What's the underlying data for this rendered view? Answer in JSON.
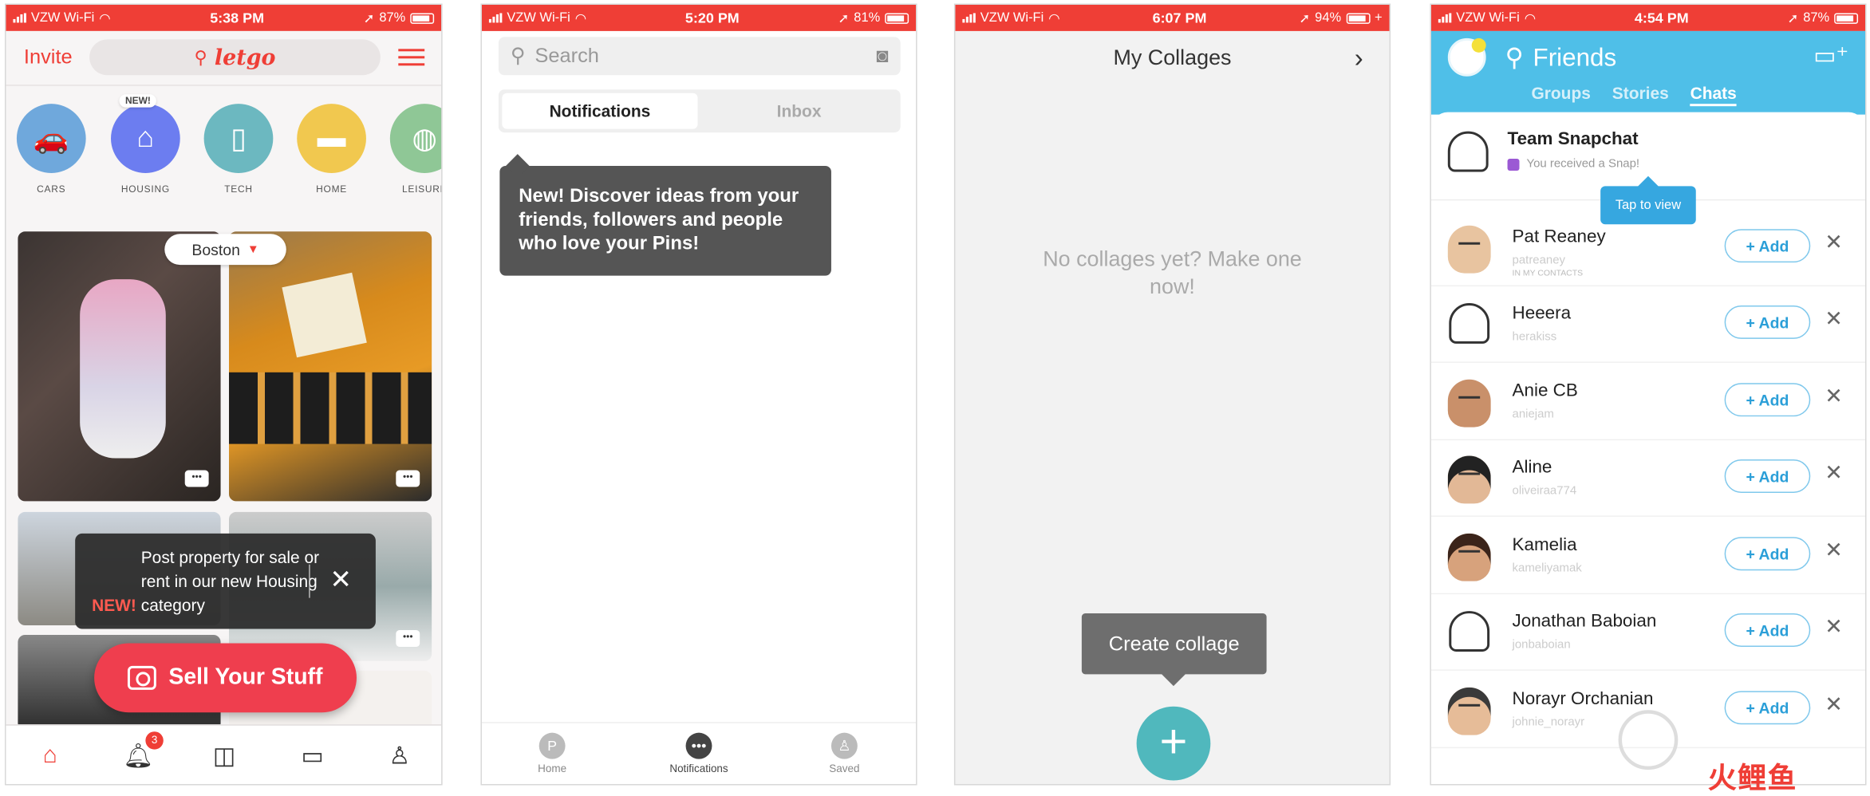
{
  "screens": {
    "letgo": {
      "status": {
        "carrier": "VZW Wi-Fi",
        "time": "5:38 PM",
        "battery": "87%"
      },
      "invite": "Invite",
      "logo": "letgo",
      "categories": [
        {
          "label": "CARS",
          "icon": "car-icon",
          "color": "#6fa8dc"
        },
        {
          "label": "HOUSING",
          "icon": "house-icon",
          "color": "#6c7df0",
          "badge": "NEW!"
        },
        {
          "label": "TECH",
          "icon": "phone-icon",
          "color": "#6cb8c0"
        },
        {
          "label": "HOME",
          "icon": "sofa-icon",
          "color": "#f1c84f"
        },
        {
          "label": "LEISURE",
          "icon": "ball-icon",
          "color": "#8fc796"
        }
      ],
      "location": "Boston",
      "tooltip": {
        "new": "NEW!",
        "text": "Post property for sale or rent in our new Housing category"
      },
      "sell_button": "Sell Your Stuff",
      "nav_badge": "3",
      "accent": "#ef3e36"
    },
    "pinterest": {
      "status": {
        "carrier": "VZW Wi-Fi",
        "time": "5:20 PM",
        "battery": "81%"
      },
      "search_placeholder": "Search",
      "tabs": [
        "Notifications",
        "Inbox"
      ],
      "tooltip": "New! Discover ideas from your friends, followers and people who love your Pins!",
      "nav": [
        "Home",
        "Notifications",
        "Saved"
      ]
    },
    "collages": {
      "status": {
        "carrier": "VZW Wi-Fi",
        "time": "6:07 PM",
        "battery": "94%"
      },
      "title": "My Collages",
      "empty": "No collages yet? Make one now!",
      "tooltip": "Create collage",
      "fab_color": "#50b8bd"
    },
    "snapchat": {
      "status": {
        "carrier": "VZW Wi-Fi",
        "time": "4:54 PM",
        "battery": "87%"
      },
      "title": "Friends",
      "tabs": [
        "Groups",
        "Stories",
        "Chats"
      ],
      "team": {
        "name": "Team Snapchat",
        "sub": "You received a Snap!"
      },
      "tap_tip": "Tap to view",
      "add_label": "+ Add",
      "friends": [
        {
          "name": "Pat Reaney",
          "user": "patreaney",
          "extra": "IN MY CONTACTS",
          "color": "#e8c4a0"
        },
        {
          "name": "Heeera",
          "user": "herakiss",
          "color": "#f0f0f0"
        },
        {
          "name": "Anie CB",
          "user": "aniejam",
          "color": "#c9906a"
        },
        {
          "name": "Aline",
          "user": "oliveiraa774",
          "color": "#e2b896"
        },
        {
          "name": "Kamelia",
          "user": "kameliyamak",
          "color": "#d7a27c"
        },
        {
          "name": "Jonathan Baboian",
          "user": "jonbaboian",
          "color": "#f0f0f0"
        },
        {
          "name": "Norayr Orchanian",
          "user": "johnie_norayr",
          "color": "#e6bc98"
        }
      ],
      "brand": "#4fbfe8"
    }
  },
  "watermark": "火鲤鱼"
}
